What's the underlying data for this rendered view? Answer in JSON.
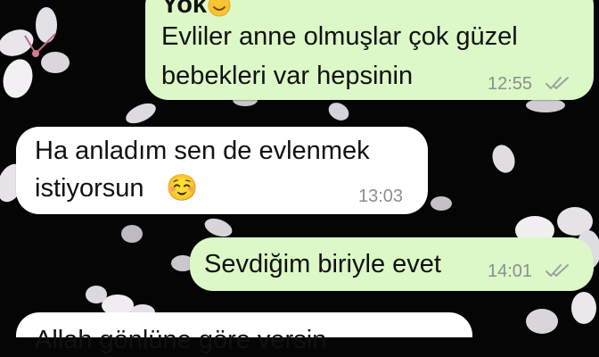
{
  "messages": [
    {
      "direction": "outgoing",
      "lines": [
        "Yok",
        "Evliler anne olmuşlar  çok güzel",
        "bebekleri var hepsinin"
      ],
      "time": "12:55",
      "status": "read-double-check-icon"
    },
    {
      "direction": "incoming",
      "lines": [
        "Ha anladım sen de evlenmek",
        "istiyorsun"
      ],
      "emoji": "☺️",
      "time": "13:03"
    },
    {
      "direction": "outgoing",
      "lines": [
        "Sevdiğim biriyle evet"
      ],
      "time": "14:01",
      "status": "read-double-check-icon"
    },
    {
      "direction": "incoming",
      "lines": [
        "Allah gönlüne göre versin"
      ]
    }
  ],
  "colors": {
    "outgoing_bubble": "#dcf8c6",
    "incoming_bubble": "#ffffff",
    "wallpaper": "#050505",
    "timestamp": "#8a8f92"
  }
}
